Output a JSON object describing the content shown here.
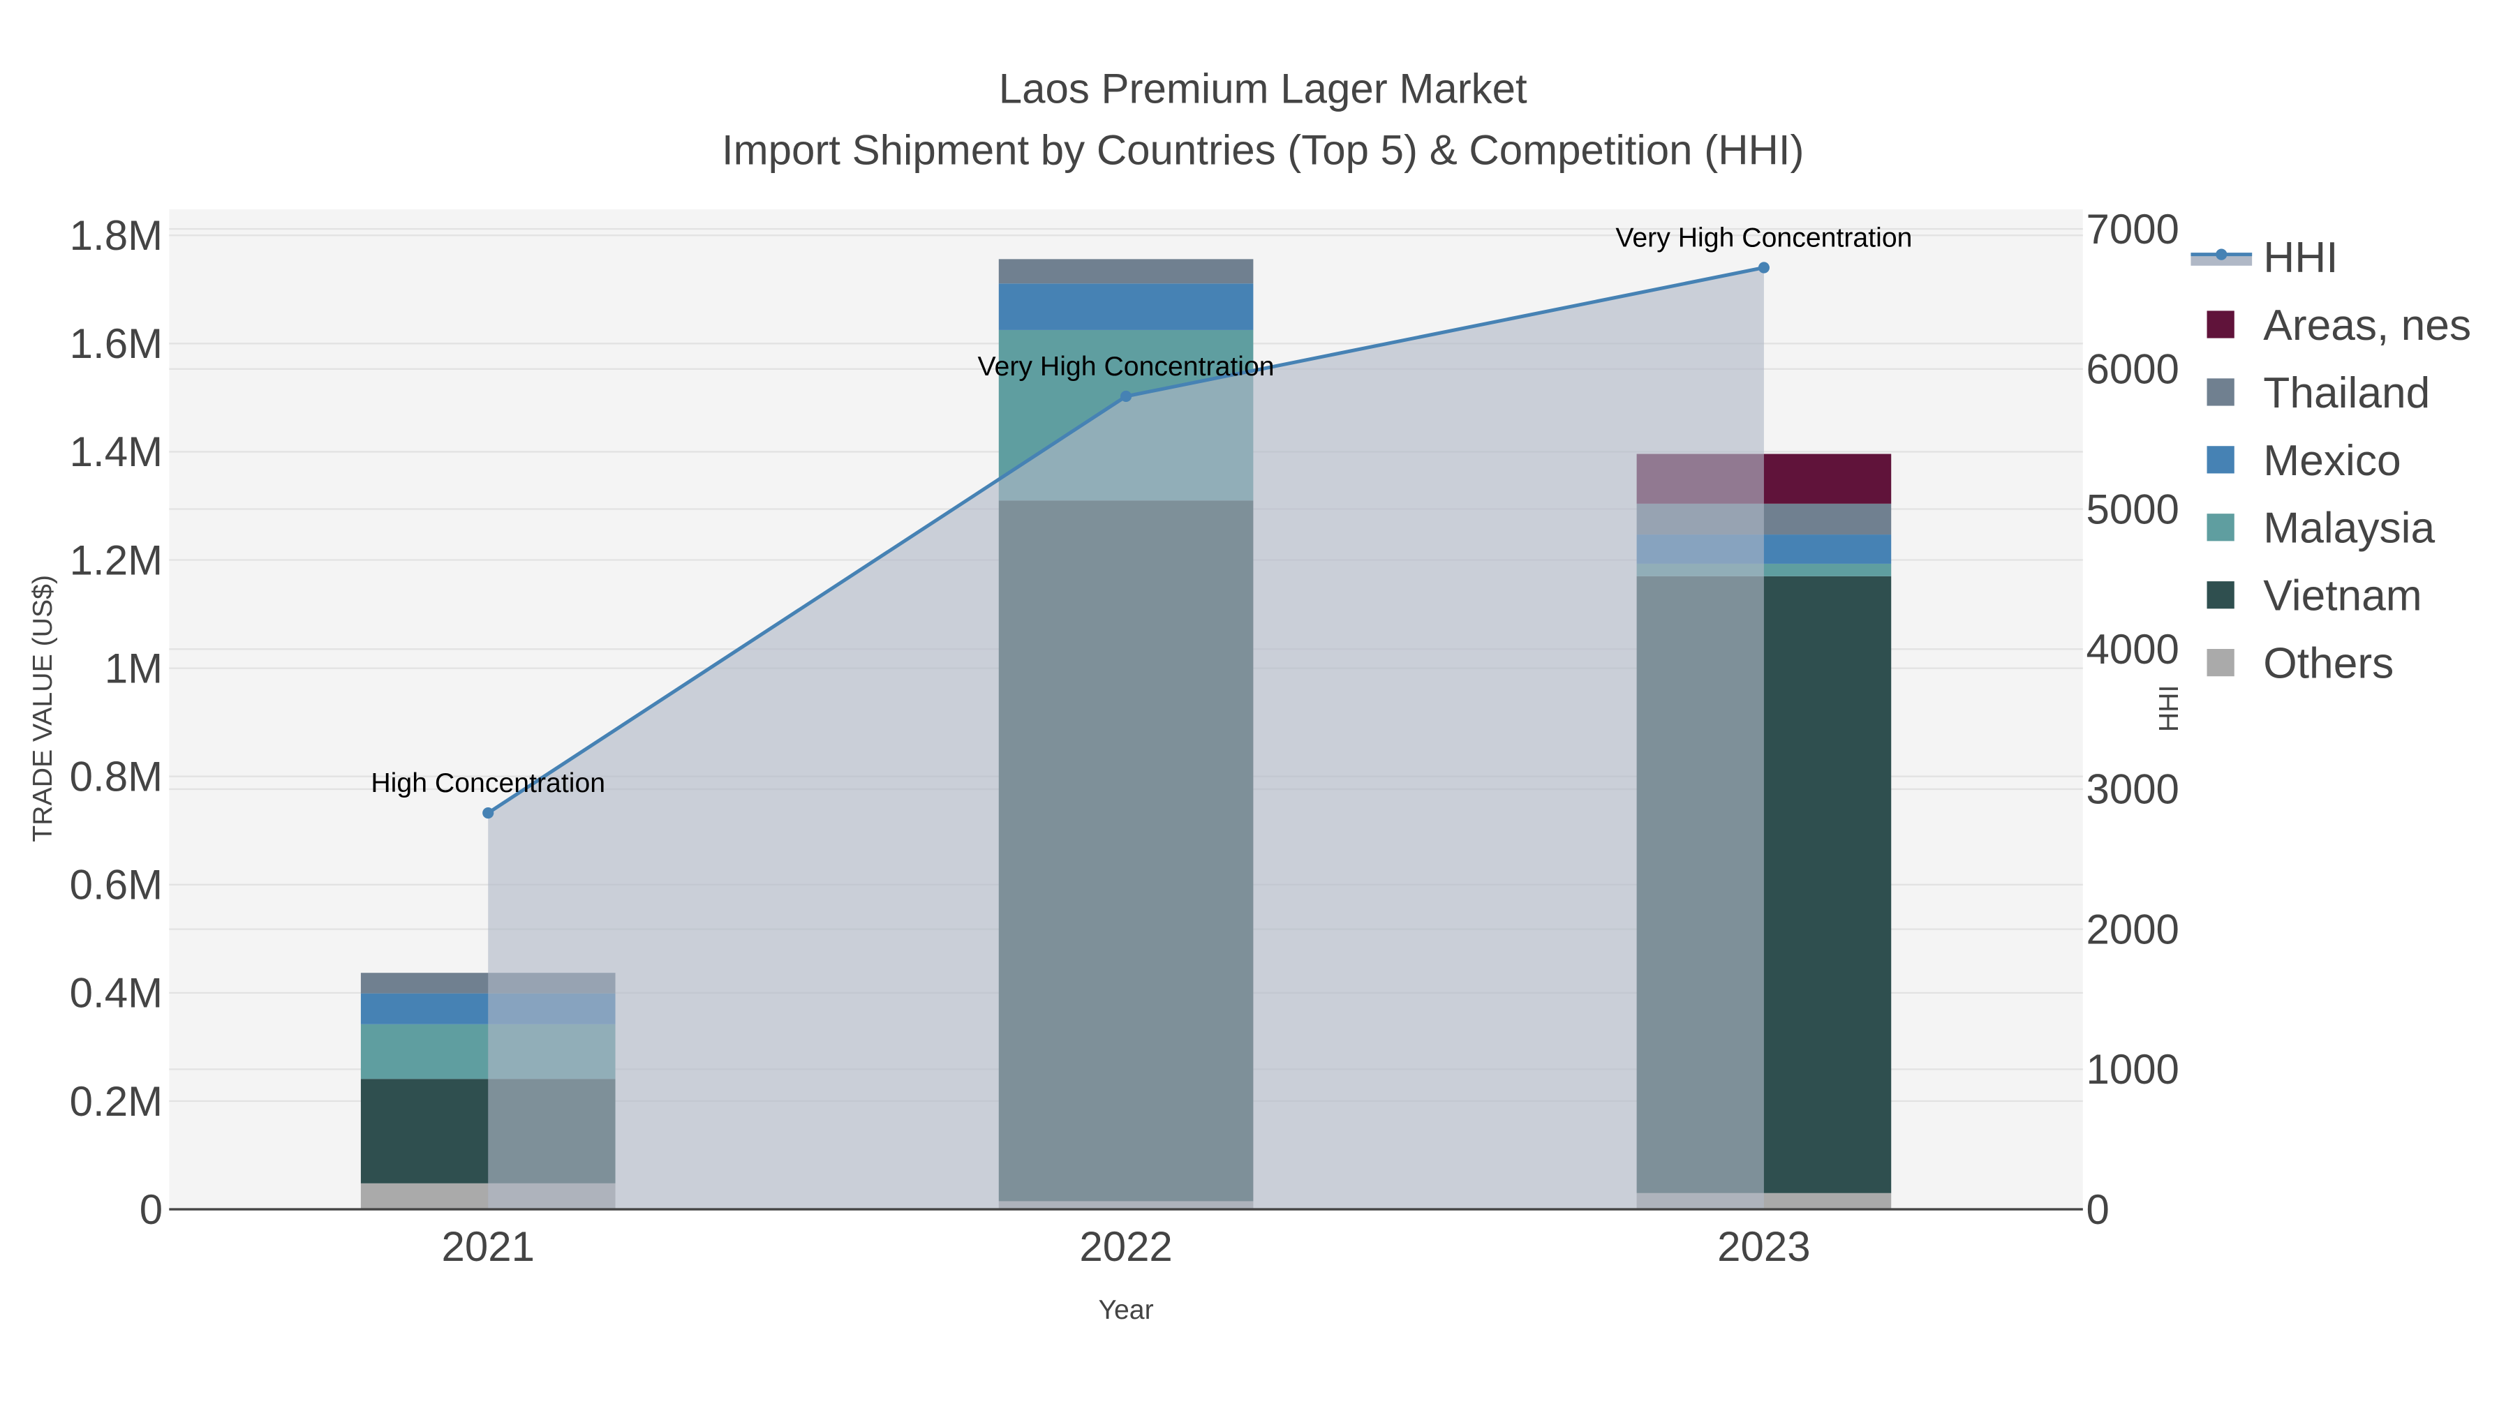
{
  "chart_data": {
    "type": "bar",
    "title": "Laos Premium Lager Market",
    "subtitle": "Import Shipment by Countries (Top 5) & Competition (HHI)",
    "xlabel": "Year",
    "ylabel": "TRADE VALUE (US$)",
    "y2label": "HHI",
    "categories": [
      "2021",
      "2022",
      "2023"
    ],
    "ylim": [
      0,
      1848000
    ],
    "y2lim": [
      0,
      7140
    ],
    "yticks": [
      {
        "v": 0,
        "label": "0"
      },
      {
        "v": 200000,
        "label": "0.2M"
      },
      {
        "v": 400000,
        "label": "0.4M"
      },
      {
        "v": 600000,
        "label": "0.6M"
      },
      {
        "v": 800000,
        "label": "0.8M"
      },
      {
        "v": 1000000,
        "label": "1M"
      },
      {
        "v": 1200000,
        "label": "1.2M"
      },
      {
        "v": 1400000,
        "label": "1.4M"
      },
      {
        "v": 1600000,
        "label": "1.6M"
      },
      {
        "v": 1800000,
        "label": "1.8M"
      }
    ],
    "y2ticks": [
      0,
      1000,
      2000,
      3000,
      4000,
      5000,
      6000,
      7000
    ],
    "stacked": true,
    "series": [
      {
        "name": "Others",
        "color": "#aaaaaa",
        "values": [
          48000,
          15000,
          30000
        ]
      },
      {
        "name": "Vietnam",
        "color": "#2f4f4f",
        "values": [
          193000,
          1295000,
          1140000
        ]
      },
      {
        "name": "Malaysia",
        "color": "#5f9ea0",
        "values": [
          101000,
          315000,
          23000
        ]
      },
      {
        "name": "Mexico",
        "color": "#4682b4",
        "values": [
          57000,
          86000,
          54000
        ]
      },
      {
        "name": "Thailand",
        "color": "#708090",
        "values": [
          38000,
          45000,
          57000
        ]
      },
      {
        "name": "Areas, nes",
        "color": "#60133a",
        "values": [
          0,
          0,
          92000
        ]
      }
    ],
    "hhi": {
      "name": "HHI",
      "color": "#4682b4",
      "values": [
        2830,
        5805,
        6724
      ],
      "annotations": [
        "High Concentration",
        "Very High Concentration",
        "Very High Concentration"
      ]
    },
    "legend_order": [
      "HHI",
      "Areas, nes",
      "Thailand",
      "Mexico",
      "Malaysia",
      "Vietnam",
      "Others"
    ],
    "legend_placement": "right",
    "grid": true
  }
}
